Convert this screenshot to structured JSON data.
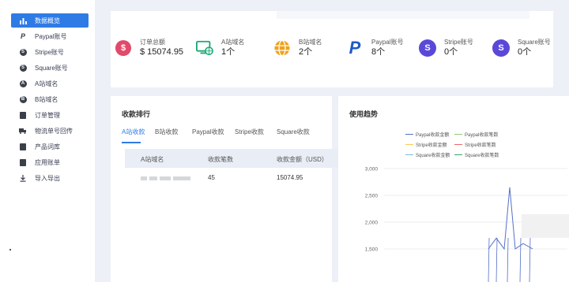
{
  "sidebar": {
    "items": [
      {
        "label": "数据概览",
        "icon": "bar-chart-icon",
        "active": true
      },
      {
        "label": "Paypal账号",
        "icon": "paypal-icon"
      },
      {
        "label": "Stripe账号",
        "icon": "stripe-icon"
      },
      {
        "label": "Square账号",
        "icon": "square-icon"
      },
      {
        "label": "A站域名",
        "icon": "a-site-icon"
      },
      {
        "label": "B站域名",
        "icon": "b-site-icon"
      },
      {
        "label": "订单管理",
        "icon": "order-icon"
      },
      {
        "label": "物流单号回传",
        "icon": "truck-icon"
      },
      {
        "label": "产品词库",
        "icon": "product-icon"
      },
      {
        "label": "应用账单",
        "icon": "bill-icon"
      },
      {
        "label": "导入导出",
        "icon": "download-icon"
      }
    ]
  },
  "stats": [
    {
      "label": "订单总额",
      "value": "$ 15074.95",
      "icon": "dollar-icon",
      "color": "#e04a6b"
    },
    {
      "label": "A站域名",
      "value": "1个",
      "icon": "monitor-globe-icon",
      "color": "#19a974"
    },
    {
      "label": "B站域名",
      "value": "2个",
      "icon": "globe-icon",
      "color": "#f0a21b"
    },
    {
      "label": "Paypal账号",
      "value": "8个",
      "icon": "paypal-logo-icon",
      "color": "#1f5bc6"
    },
    {
      "label": "Stripe账号",
      "value": "0个",
      "icon": "stripe-logo-icon",
      "color": "#5a48d8"
    },
    {
      "label": "Square账号",
      "value": "0个",
      "icon": "square-logo-icon",
      "color": "#5a48d8"
    }
  ],
  "ranking": {
    "title": "收款排行",
    "tabs": [
      "A站收款",
      "B站收款",
      "Paypal收款",
      "Stripe收款",
      "Square收款"
    ],
    "active_tab": 0,
    "columns": [
      "A站域名",
      "收款笔数",
      "收款金额（USD）"
    ],
    "rows": [
      {
        "domain": "",
        "count": "45",
        "amount": "15074.95"
      }
    ]
  },
  "trend": {
    "title": "使用趋势",
    "legend": [
      {
        "name": "Paypal收款金额",
        "color": "#5470c6"
      },
      {
        "name": "Paypal收款笔数",
        "color": "#91cc75"
      },
      {
        "name": "Stripe收款金额",
        "color": "#fac858"
      },
      {
        "name": "Stripe收款笔数",
        "color": "#ee6666"
      },
      {
        "name": "Square收款金额",
        "color": "#73c0de"
      },
      {
        "name": "Square收款笔数",
        "color": "#3ba272"
      }
    ],
    "y_ticks": [
      "3,000",
      "2,500",
      "2,000",
      "1,500"
    ]
  },
  "chart_data": {
    "type": "line",
    "title": "使用趋势",
    "ylim": [
      1500,
      3000
    ],
    "y_ticks": [
      3000,
      2500,
      2000,
      1500
    ],
    "series": [
      {
        "name": "Paypal收款金额",
        "values": [
          1500,
          1700,
          1500,
          2650,
          1500,
          1600,
          1500
        ]
      },
      {
        "name": "Paypal收款笔数",
        "values": []
      },
      {
        "name": "Stripe收款金额",
        "values": []
      },
      {
        "name": "Stripe收款笔数",
        "values": []
      },
      {
        "name": "Square收款金额",
        "values": []
      },
      {
        "name": "Square收款笔数",
        "values": []
      }
    ]
  }
}
